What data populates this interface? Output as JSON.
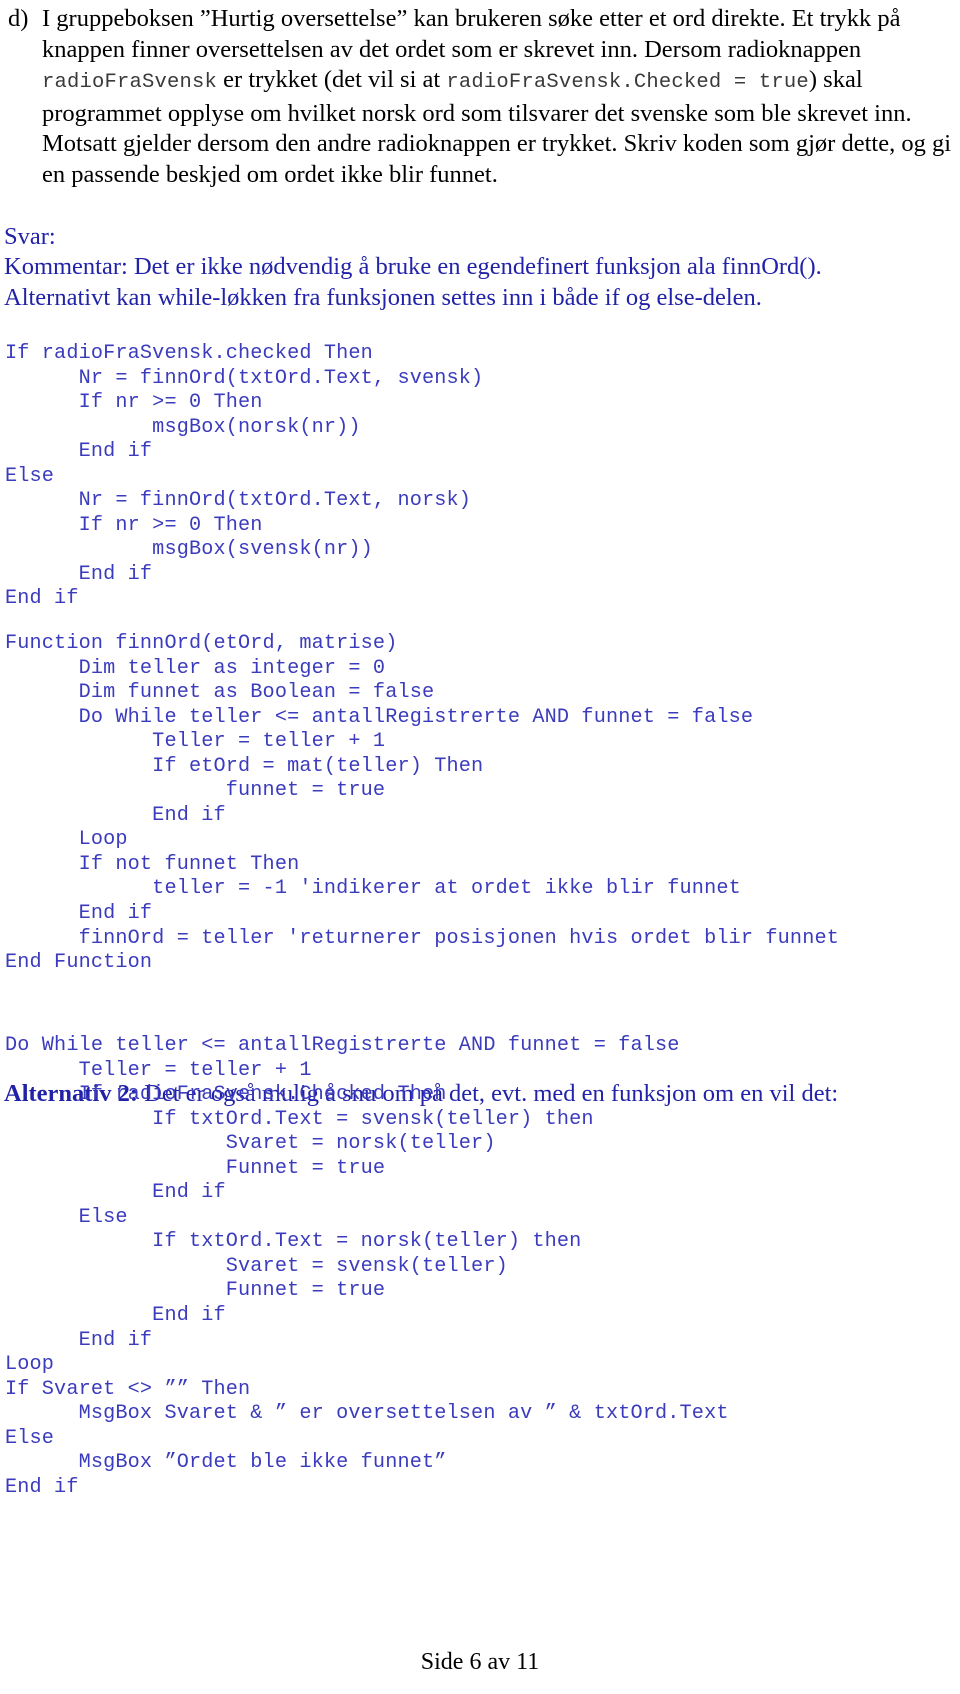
{
  "question": {
    "marker": "d)",
    "segments": [
      {
        "type": "text",
        "value": "I gruppeboksen ”Hurtig oversettelse” kan brukeren søke etter et ord direkte. Et trykk på knappen finner oversettelsen av det ordet som er skrevet inn. Dersom radioknappen "
      },
      {
        "type": "mono",
        "value": "radioFraSvensk"
      },
      {
        "type": "text",
        "value": " er trykket (det vil si at "
      },
      {
        "type": "mono",
        "value": "radioFraSvensk.Checked = true"
      },
      {
        "type": "text",
        "value": ") skal programmet opplyse om hvilket norsk ord som tilsvarer det svenske som ble skrevet inn. Motsatt gjelder dersom den andre radioknappen er trykket. Skriv koden som gjør dette, og gi en passende beskjed om ordet ikke blir funnet."
      }
    ]
  },
  "answer": {
    "lines": [
      "Svar:",
      "Kommentar: Det er ikke nødvendig å bruke en egendefinert funksjon ala finnOrd().",
      "Alternativt kan while-løkken fra funksjonen settes inn i både if og else-delen."
    ]
  },
  "code_main": {
    "lines": [
      "If radioFraSvensk.checked Then",
      "      Nr = finnOrd(txtOrd.Text, svensk)",
      "      If nr >= 0 Then",
      "            msgBox(norsk(nr))",
      "      End if",
      "Else",
      "      Nr = finnOrd(txtOrd.Text, norsk)",
      "      If nr >= 0 Then",
      "            msgBox(svensk(nr))",
      "      End if",
      "End if"
    ]
  },
  "code_function": {
    "lines": [
      "Function finnOrd(etOrd, matrise)",
      "      Dim teller as integer = 0",
      "      Dim funnet as Boolean = false",
      "      Do While teller <= antallRegistrerte AND funnet = false",
      "            Teller = teller + 1",
      "            If etOrd = mat(teller) Then",
      "                  funnet = true",
      "            End if",
      "      Loop",
      "      If not funnet Then",
      "            teller = -1 'indikerer at ordet ikke blir funnet",
      "      End if",
      "      finnOrd = teller 'returnerer posisjonen hvis ordet blir funnet",
      "End Function"
    ]
  },
  "alt2_heading": {
    "strong": "Alternativ 2:",
    "rest": " Det er også mulig å snu om på det, evt. med en funksjon om en vil det:"
  },
  "code_alt2": {
    "lines": [
      "Do While teller <= antallRegistrerte AND funnet = false",
      "      Teller = teller + 1",
      "      If radioFraSvensk.Checked Then",
      "            If txtOrd.Text = svensk(teller) then",
      "                  Svaret = norsk(teller)",
      "                  Funnet = true",
      "            End if",
      "      Else",
      "            If txtOrd.Text = norsk(teller) then",
      "                  Svaret = svensk(teller)",
      "                  Funnet = true",
      "            End if",
      "      End if",
      "Loop",
      "If Svaret <> ”” Then",
      "      MsgBox Svaret & ” er oversettelsen av ” & txtOrd.Text",
      "Else",
      "      MsgBox ”Ordet ble ikke funnet”",
      "End if"
    ]
  },
  "footer": {
    "page_label": "Side 6 av 11"
  },
  "colors": {
    "code_blue": "#3b3bbd",
    "answer_blue": "#2222a8",
    "body_black": "#000000",
    "mono_inline_grey": "#3a3a3a"
  }
}
